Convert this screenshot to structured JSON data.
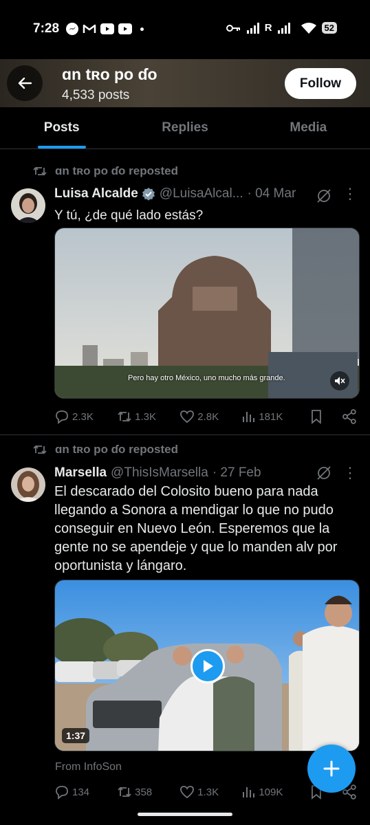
{
  "status_bar": {
    "time": "7:28",
    "battery": "52",
    "app_icons": [
      "messenger-icon",
      "gmail-icon",
      "youtube-icon",
      "youtube-icon"
    ],
    "network": "R"
  },
  "header": {
    "title": "ɑn tʀo po ɗo",
    "posts_count": "4,533 posts",
    "follow_label": "Follow"
  },
  "tabs": [
    {
      "label": "Posts",
      "active": true
    },
    {
      "label": "Replies",
      "active": false
    },
    {
      "label": "Media",
      "active": false
    }
  ],
  "posts": [
    {
      "repost_text": "ɑn tʀo po ɗo reposted",
      "name": "Luisa Alcalde",
      "verified": true,
      "handle": "@LuisaAlcal...",
      "date": "· 04 Mar",
      "text": "Y tú, ¿de qué lado estás?",
      "video_caption": "Pero hay otro México, uno mucho más grande.",
      "replies": "2.3K",
      "reposts": "1.3K",
      "likes": "2.8K",
      "views": "181K"
    },
    {
      "repost_text": "ɑn tʀo po ɗo reposted",
      "name": "Marsella",
      "verified": false,
      "handle": "@ThisIsMarsella",
      "date": "· 27 Feb",
      "text": "El descarado del Colosito bueno para nada llegando a Sonora a mendigar lo que no pudo conseguir en Nuevo León. Esperemos que la gente no se apendeje y que lo manden alv por oportunista y lángaro.",
      "video_duration": "1:37",
      "source": "From InfoSon",
      "replies": "134",
      "reposts": "358",
      "likes": "1.3K",
      "views": "109K"
    }
  ],
  "colors": {
    "accent": "#1d9bf0",
    "background": "#000000",
    "muted": "#71767b",
    "text": "#e7e9ea"
  }
}
